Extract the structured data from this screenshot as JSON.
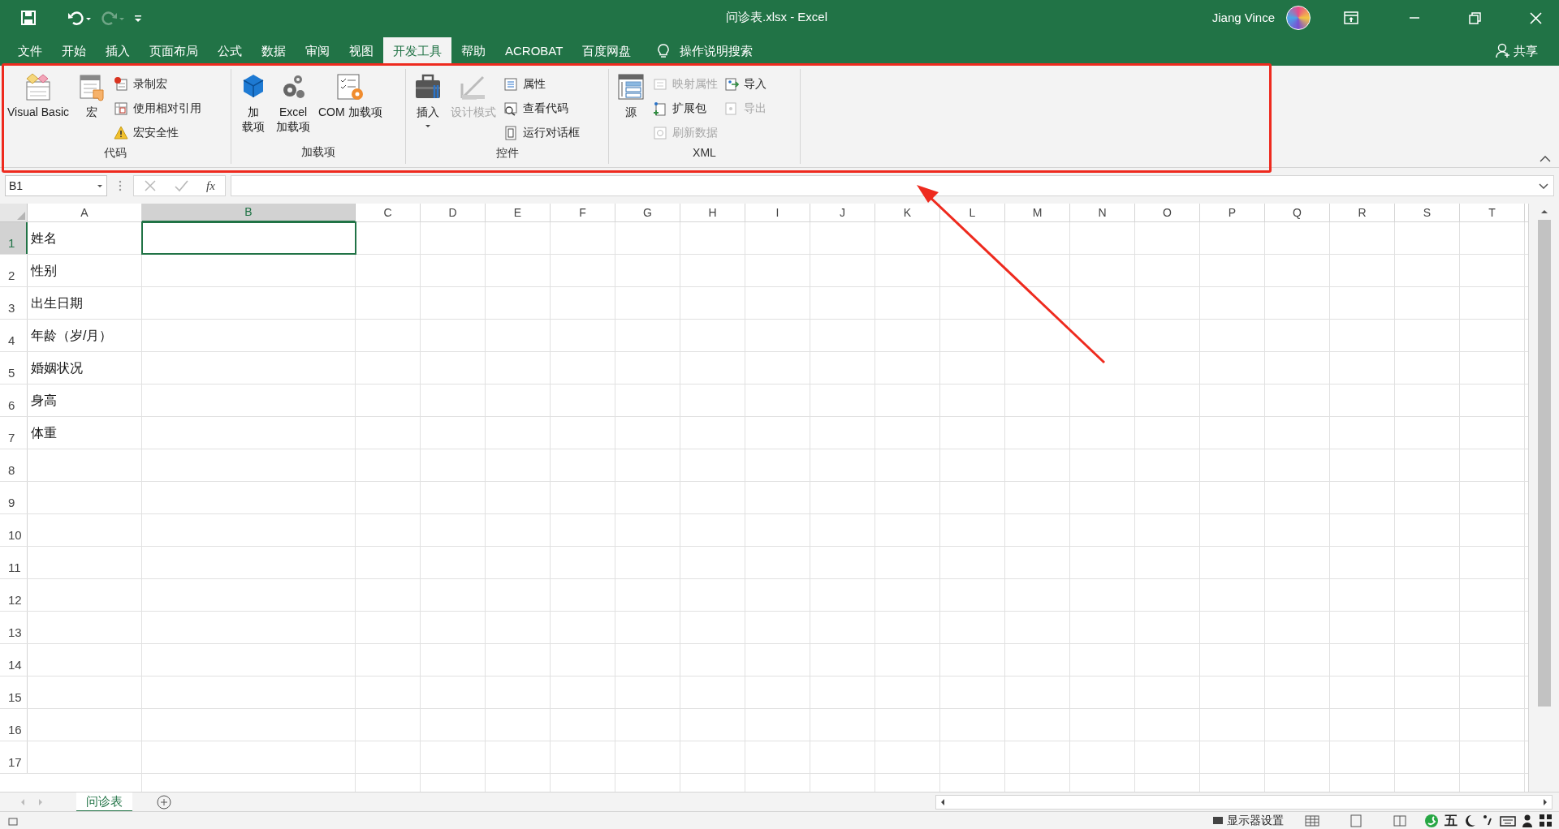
{
  "window": {
    "title": "问诊表.xlsx  -  Excel",
    "user": "Jiang Vince",
    "share": "共享"
  },
  "tabs": [
    {
      "label": "文件",
      "selected": false
    },
    {
      "label": "开始",
      "selected": false
    },
    {
      "label": "插入",
      "selected": false
    },
    {
      "label": "页面布局",
      "selected": false
    },
    {
      "label": "公式",
      "selected": false
    },
    {
      "label": "数据",
      "selected": false
    },
    {
      "label": "审阅",
      "selected": false
    },
    {
      "label": "视图",
      "selected": false
    },
    {
      "label": "开发工具",
      "selected": true
    },
    {
      "label": "帮助",
      "selected": false
    },
    {
      "label": "ACROBAT",
      "selected": false
    },
    {
      "label": "百度网盘",
      "selected": false
    }
  ],
  "tell_me": "操作说明搜索",
  "ribbon_groups": [
    {
      "label": "代码",
      "items": [
        {
          "kind": "large",
          "lines": [
            "Visual Basic"
          ],
          "disabled": false
        },
        {
          "kind": "large",
          "lines": [
            "宏"
          ],
          "disabled": false
        },
        {
          "kind": "stack",
          "items": [
            {
              "label": "录制宏",
              "disabled": false
            },
            {
              "label": "使用相对引用",
              "disabled": false
            },
            {
              "label": "宏安全性",
              "disabled": false
            }
          ]
        }
      ]
    },
    {
      "label": "加载项",
      "items": [
        {
          "kind": "large",
          "lines": [
            "加",
            "载项"
          ],
          "disabled": false
        },
        {
          "kind": "large",
          "lines": [
            "Excel",
            "加载项"
          ],
          "disabled": false
        },
        {
          "kind": "large",
          "lines": [
            "COM 加载项"
          ],
          "disabled": false
        }
      ]
    },
    {
      "label": "控件",
      "items": [
        {
          "kind": "large",
          "lines": [
            "插入"
          ],
          "dropdown": true,
          "disabled": false
        },
        {
          "kind": "large",
          "lines": [
            "设计模式"
          ],
          "disabled": true
        },
        {
          "kind": "stack",
          "items": [
            {
              "label": "属性",
              "disabled": false
            },
            {
              "label": "查看代码",
              "disabled": false
            },
            {
              "label": "运行对话框",
              "disabled": false
            }
          ]
        }
      ]
    },
    {
      "label": "XML",
      "items": [
        {
          "kind": "large",
          "lines": [
            "源"
          ],
          "disabled": false
        },
        {
          "kind": "stack",
          "items": [
            {
              "label": "映射属性",
              "disabled": true
            },
            {
              "label": "扩展包",
              "disabled": false
            },
            {
              "label": "刷新数据",
              "disabled": true
            }
          ]
        },
        {
          "kind": "stack",
          "items": [
            {
              "label": "导入",
              "disabled": false
            },
            {
              "label": "导出",
              "disabled": true
            }
          ]
        }
      ]
    }
  ],
  "name_box": "B1",
  "formula_icon": "fx",
  "columns": [
    {
      "label": "A",
      "selected": false
    },
    {
      "label": "B",
      "selected": true
    },
    {
      "label": "C",
      "selected": false
    },
    {
      "label": "D",
      "selected": false
    },
    {
      "label": "E",
      "selected": false
    },
    {
      "label": "F",
      "selected": false
    },
    {
      "label": "G",
      "selected": false
    },
    {
      "label": "H",
      "selected": false
    },
    {
      "label": "I",
      "selected": false
    },
    {
      "label": "J",
      "selected": false
    },
    {
      "label": "K",
      "selected": false
    },
    {
      "label": "L",
      "selected": false
    },
    {
      "label": "M",
      "selected": false
    },
    {
      "label": "N",
      "selected": false
    },
    {
      "label": "O",
      "selected": false
    },
    {
      "label": "P",
      "selected": false
    },
    {
      "label": "Q",
      "selected": false
    },
    {
      "label": "R",
      "selected": false
    },
    {
      "label": "S",
      "selected": false
    },
    {
      "label": "T",
      "selected": false
    }
  ],
  "rows": [
    {
      "label": "1",
      "selected": true,
      "column_a": "姓名"
    },
    {
      "label": "2",
      "selected": false,
      "column_a": "性别"
    },
    {
      "label": "3",
      "selected": false,
      "column_a": "出生日期"
    },
    {
      "label": "4",
      "selected": false,
      "column_a": "年龄（岁/月）"
    },
    {
      "label": "5",
      "selected": false,
      "column_a": "婚姻状况"
    },
    {
      "label": "6",
      "selected": false,
      "column_a": "身高"
    },
    {
      "label": "7",
      "selected": false,
      "column_a": "体重"
    },
    {
      "label": "8",
      "selected": false
    },
    {
      "label": "9",
      "selected": false
    },
    {
      "label": "10",
      "selected": false
    },
    {
      "label": "11",
      "selected": false
    },
    {
      "label": "12",
      "selected": false
    },
    {
      "label": "13",
      "selected": false
    },
    {
      "label": "14",
      "selected": false
    },
    {
      "label": "15",
      "selected": false
    },
    {
      "label": "16",
      "selected": false
    },
    {
      "label": "17",
      "selected": false
    }
  ],
  "sheet_tabs": [
    {
      "label": "问诊表",
      "selected": true
    }
  ],
  "status_bar": {
    "display_settings": "显示器设置",
    "ime": "五"
  }
}
